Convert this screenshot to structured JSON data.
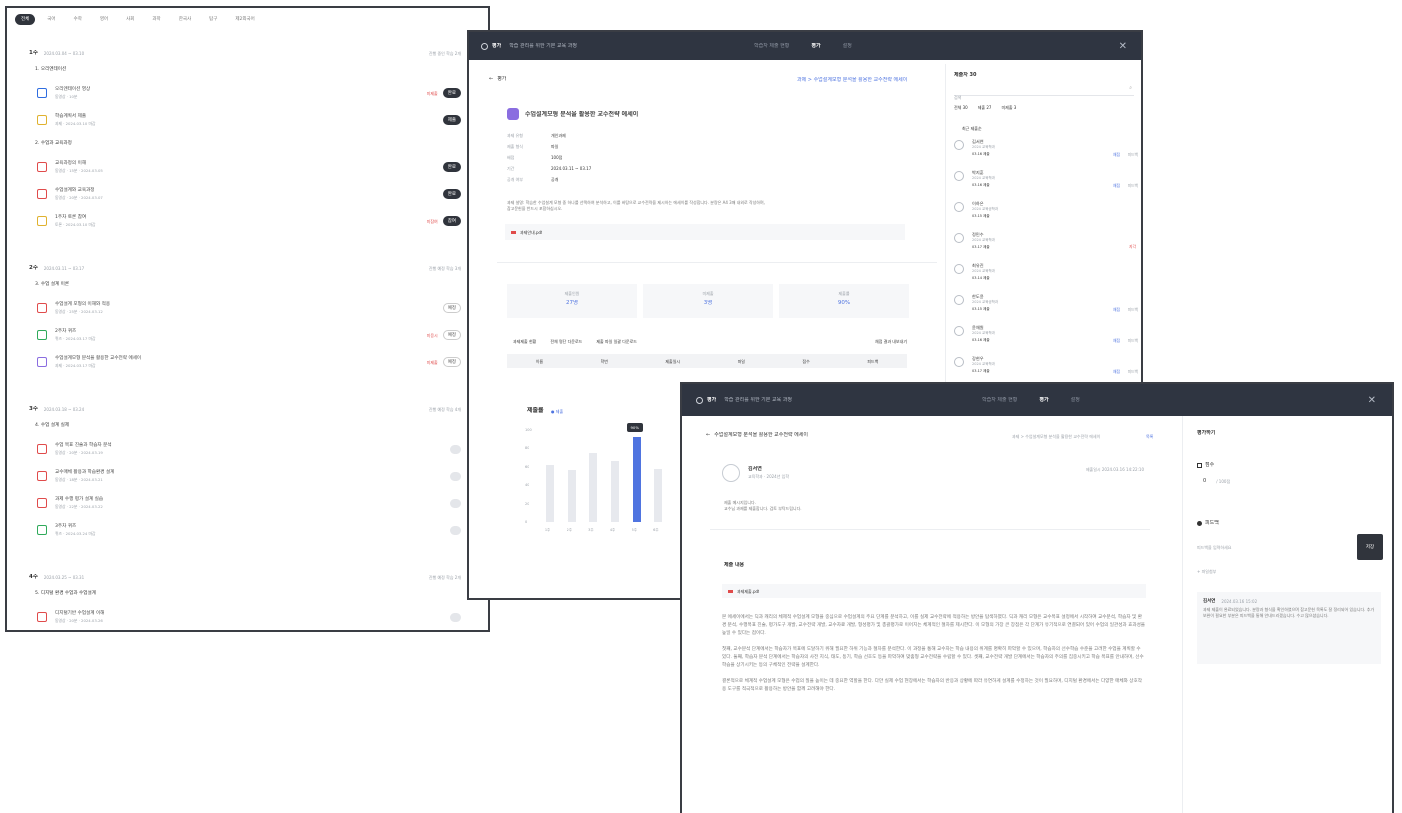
{
  "win1": {
    "tabs": [
      "전체",
      "국어",
      "수학",
      "영어",
      "사회",
      "과학",
      "한국사",
      "탐구",
      "제2외국어"
    ],
    "weeks": [
      {
        "label": "1주",
        "meta": "2024.03.04 ~ 03.10",
        "right": "진행 중인 학습 2개",
        "sections": [
          {
            "title": "1. 오리엔테이션",
            "items": [
              {
                "color": "#2f6de0",
                "title": "오리엔테이션 영상",
                "sub": "동영상 · 10분",
                "badge": "완료",
                "tag": "미제출"
              },
              {
                "color": "#e0b22f",
                "title": "학습계획서 제출",
                "sub": "과제 · 2024.03.10 마감",
                "badge": "제출",
                "tag": ""
              }
            ]
          },
          {
            "title": "2. 수업과 교육과정",
            "items": [
              {
                "color": "#e04b4b",
                "title": "교육과정의 이해",
                "sub": "동영상 · 15분 · 2024.03.05",
                "badge": "완료",
                "tag": ""
              },
              {
                "color": "#e04b4b",
                "title": "수업설계와 교육과정",
                "sub": "동영상 · 20분 · 2024.03.07",
                "badge": "완료",
                "tag": ""
              },
              {
                "color": "#e0b22f",
                "title": "1주차 토론 참여",
                "sub": "토론 · 2024.03.10 마감",
                "badge": "참여",
                "tag": "미참여"
              }
            ]
          }
        ]
      },
      {
        "label": "2주",
        "meta": "2024.03.11 ~ 03.17",
        "right": "진행 예정 학습 3개",
        "sections": [
          {
            "title": "3. 수업 설계 이론",
            "items": [
              {
                "color": "#e04b4b",
                "title": "수업설계 모형의 이해와 적용",
                "sub": "동영상 · 25분 · 2024.03.12",
                "badge": "예정",
                "tag": ""
              },
              {
                "color": "#2faa5a",
                "title": "2주차 퀴즈",
                "sub": "퀴즈 · 2024.03.17 마감",
                "badge": "예정",
                "tag": "미응시"
              },
              {
                "color": "#8a6de0",
                "title": "수업설계모형 분석을 활용한 교수전략 에세이",
                "sub": "과제 · 2024.03.17 마감",
                "badge": "예정",
                "tag": "미제출"
              }
            ]
          }
        ]
      },
      {
        "label": "3주",
        "meta": "2024.03.18 ~ 03.24",
        "right": "진행 예정 학습 4개",
        "sections": [
          {
            "title": "4. 수업 설계 실제",
            "items": [
              {
                "color": "#e04b4b",
                "title": "수업 목표 진술과 학습자 분석",
                "sub": "동영상 · 20분 · 2024.03.19",
                "badge": "",
                "tag": ""
              },
              {
                "color": "#e04b4b",
                "title": "교수매체 활용과 학습환경 설계",
                "sub": "동영상 · 18분 · 2024.03.21",
                "badge": "",
                "tag": ""
              },
              {
                "color": "#e04b4b",
                "title": "과제 수행 평가 설계 실습",
                "sub": "동영상 · 22분 · 2024.03.22",
                "badge": "",
                "tag": ""
              },
              {
                "color": "#2faa5a",
                "title": "3주차 퀴즈",
                "sub": "퀴즈 · 2024.03.24 마감",
                "badge": "",
                "tag": ""
              }
            ]
          }
        ]
      },
      {
        "label": "4주",
        "meta": "2024.03.25 ~ 03.31",
        "right": "진행 예정 학습 2개",
        "sections": [
          {
            "title": "5. 디지털 환경 수업과 수업설계",
            "items": [
              {
                "color": "#e04b4b",
                "title": "디지털기반 수업설계 이해",
                "sub": "동영상 · 20분 · 2024.03.26",
                "badge": "",
                "tag": ""
              }
            ]
          }
        ]
      }
    ]
  },
  "win2": {
    "header": {
      "logo": "평가",
      "title": "학습 관리를 위한 기본 교육 과정",
      "tabs": [
        "학습자 제출 현황",
        "평가",
        "설정"
      ],
      "active": 1
    },
    "back": "평가",
    "breadcrumb": "과제 > 수업설계모형 분석을 활용한 교수전략 에세이",
    "assignment": {
      "title": "수업설계모형 분석을 활용한 교수전략 에세이",
      "meta": [
        [
          "과제 유형",
          "개인과제"
        ],
        [
          "제출 형식",
          "파일"
        ],
        [
          "배점",
          "100점"
        ],
        [
          "기간",
          "2024.03.11 ~ 03.17"
        ],
        [
          "공개 여부",
          "공개"
        ]
      ],
      "desc": "과제 설명: 학습한 수업설계 모형 중 하나를 선택하여 분석하고, 이를 바탕으로 교수전략을 제시하는 에세이를 작성합니다. 분량은 A4 3매 내외로 작성하며, 참고문헌을 반드시 포함하십시오.",
      "file": "과제안내.pdf"
    },
    "stats": [
      {
        "label": "제출인원",
        "value": "27명"
      },
      {
        "label": "미제출",
        "value": "3명"
      },
      {
        "label": "제출률",
        "value": "90%"
      }
    ],
    "toolbar": [
      "과제제출 현황",
      "전체 명단 다운로드",
      "제출 파일 일괄 다운로드",
      "채점 결과 내보내기"
    ],
    "table_headers": [
      "이름",
      "학번",
      "제출일시",
      "파일",
      "점수",
      "피드백"
    ],
    "chart": {
      "title": "제출률",
      "legend": "● 제출",
      "tooltip": "90%"
    },
    "chart_data": {
      "type": "bar",
      "categories": [
        "1주",
        "2주",
        "3주",
        "4주",
        "5주",
        "6주"
      ],
      "values": [
        62,
        56,
        75,
        66,
        92,
        58
      ],
      "ylim": [
        0,
        100
      ],
      "highlight": 4
    },
    "side": {
      "title": "제출자 30",
      "search": "검색",
      "filters": [
        "전체 30",
        "제출 27",
        "미제출 3"
      ],
      "sort": "최근 제출순",
      "list": [
        {
          "name": "김서연",
          "sub": "2024 교육학과",
          "date": "03.16 제출",
          "a": "채점",
          "b": "피드백",
          "late": false
        },
        {
          "name": "박지훈",
          "sub": "2024 교육학과",
          "date": "03.16 제출",
          "a": "채점",
          "b": "피드백",
          "late": false
        },
        {
          "name": "이하은",
          "sub": "2024 교육공학과",
          "date": "03.15 제출",
          "a": "",
          "b": "",
          "late": false
        },
        {
          "name": "정민수",
          "sub": "2024 교육학과",
          "date": "03.17 제출",
          "a": "",
          "b": "",
          "late": true
        },
        {
          "name": "최유진",
          "sub": "2024 교육학과",
          "date": "03.14 제출",
          "a": "",
          "b": "",
          "late": false
        },
        {
          "name": "한도윤",
          "sub": "2024 교육공학과",
          "date": "03.15 제출",
          "a": "채점",
          "b": "피드백",
          "late": false
        },
        {
          "name": "윤채원",
          "sub": "2024 교육학과",
          "date": "03.16 제출",
          "a": "채점",
          "b": "피드백",
          "late": false
        },
        {
          "name": "강현우",
          "sub": "2024 교육학과",
          "date": "03.17 제출",
          "a": "채점",
          "b": "피드백",
          "late": false
        }
      ],
      "late_label": "지각"
    }
  },
  "win3": {
    "header": {
      "logo": "평가",
      "title": "학습 관리를 위한 기본 교육 과정",
      "tabs": [
        "학습자 제출 현황",
        "평가",
        "설정"
      ],
      "active": 1
    },
    "back": "수업설계모형 분석을 활용한 교수전략 에세이",
    "breadcrumb": "과제 > 수업설계모형 분석을 활용한 교수전략 에세이",
    "breadcrumb_link": "목록",
    "student": {
      "name": "김서연",
      "sub": "교육학과 · 2024년 입학",
      "submitted": "제출일시 2024.03.16 14:22:10"
    },
    "note": "제출 메시지입니다.\n교수님 과제를 제출합니다. 검토 부탁드립니다.",
    "section": "제출 내용",
    "file": "과제제출.pdf",
    "paragraphs": [
      "본 에세이에서는 딕과 캐리의 체제적 수업설계 모형을 중심으로 수업설계의 주요 단계를 분석하고, 이를 실제 교수전략에 적용하는 방안을 탐색하였다. 딕과 캐리 모형은 교수목표 설정에서 시작하여 교수분석, 학습자 및 환경 분석, 수행목표 진술, 평가도구 개발, 교수전략 개발, 교수자료 개발, 형성평가 및 총괄평가로 이어지는 체계적인 절차를 제시한다. 이 모형의 가장 큰 장점은 각 단계가 유기적으로 연결되어 있어 수업의 일관성과 효과성을 높일 수 있다는 점이다.",
      "첫째, 교수분석 단계에서는 학습자가 목표에 도달하기 위해 필요한 하위 기능과 절차를 분석한다. 이 과정을 통해 교수자는 학습 내용의 위계를 명확히 파악할 수 있으며, 학습자의 선수학습 수준을 고려한 수업을 계획할 수 있다. 둘째, 학습자 분석 단계에서는 학습자의 사전 지식, 태도, 동기, 학습 선호도 등을 파악하여 맞춤형 교수전략을 수립할 수 있다. 셋째, 교수전략 개발 단계에서는 학습자의 주의를 집중시키고 학습 목표를 안내하며, 선수학습을 상기시키는 등의 구체적인 전략을 설계한다.",
      "결론적으로 체계적 수업설계 모형은 수업의 질을 높이는 데 중요한 역할을 한다. 다만 실제 수업 현장에서는 학습자의 반응과 상황에 따라 유연하게 설계를 수정하는 것이 필요하며, 디지털 환경에서는 다양한 매체와 상호작용 도구를 적극적으로 활용하는 방안을 함께 고려해야 한다."
    ],
    "side": {
      "title": "평가하기",
      "score_label": "점수",
      "score_value": "0",
      "score_max": "/ 100점",
      "feedback_label": "피드백",
      "feedback_placeholder": "피드백을 입력하세요",
      "save": "저장",
      "file_hint": "+ 파일첨부",
      "prev": {
        "name": "김서연",
        "date": "2024.03.16 15:02",
        "text": "과제 제출이 완료되었습니다. 분량과 형식을 확인하였으며 참고문헌 목록도 잘 정리되어 있습니다. 추가 보완이 필요한 부분은 피드백을 통해 안내드리겠습니다. 수고 많으셨습니다."
      }
    }
  }
}
